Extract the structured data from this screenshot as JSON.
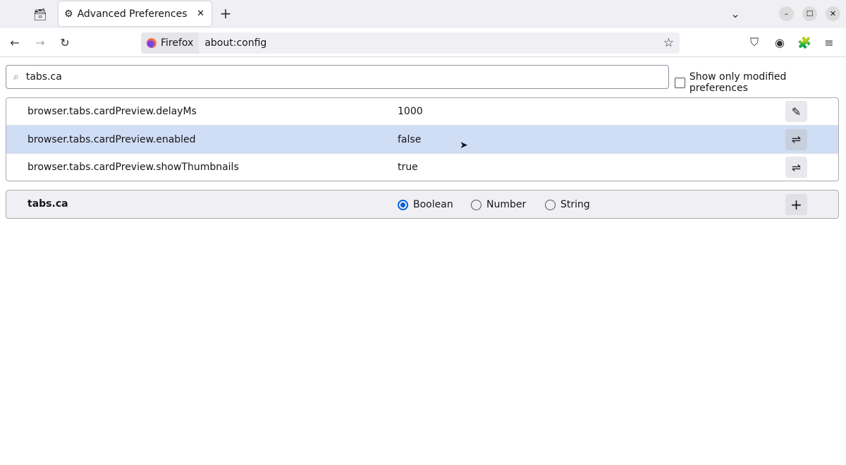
{
  "tab": {
    "title": "Advanced Preferences"
  },
  "urlbar": {
    "identity": "Firefox",
    "url": "about:config"
  },
  "search": {
    "value": "tabs.ca"
  },
  "filter": {
    "label": "Show only modified preferences",
    "checked": false
  },
  "prefs": [
    {
      "name": "browser.tabs.cardPreview.delayMs",
      "value": "1000",
      "action": "edit-icon",
      "selected": false
    },
    {
      "name": "browser.tabs.cardPreview.enabled",
      "value": "false",
      "action": "toggle-icon",
      "selected": true
    },
    {
      "name": "browser.tabs.cardPreview.showThumbnails",
      "value": "true",
      "action": "toggle-icon",
      "selected": false
    }
  ],
  "new_pref": {
    "name": "tabs.ca",
    "types": [
      "Boolean",
      "Number",
      "String"
    ],
    "selected_type": "Boolean"
  },
  "colors": {
    "accent": "#0061e0",
    "selected_row": "#cfdef5"
  }
}
